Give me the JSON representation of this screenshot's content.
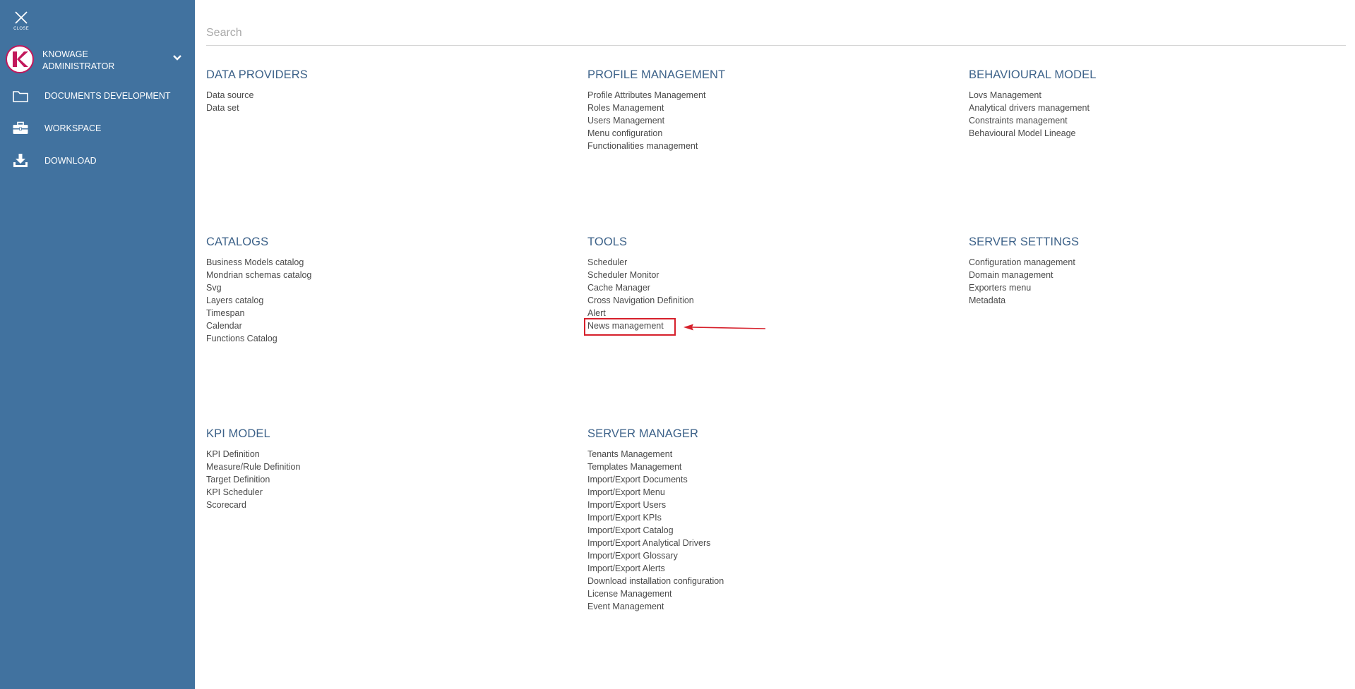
{
  "sidebar": {
    "close_label": "CLOSE",
    "user": {
      "line1": "KNOWAGE",
      "line2": "ADMINISTRATOR",
      "avatar_icon": "knowage-logo",
      "brand_color": "#c2185b"
    },
    "items": [
      {
        "label": "DOCUMENTS DEVELOPMENT",
        "icon": "folder-icon"
      },
      {
        "label": "WORKSPACE",
        "icon": "briefcase-icon"
      },
      {
        "label": "DOWNLOAD",
        "icon": "download-icon"
      }
    ],
    "background_color": "#41729f"
  },
  "search": {
    "placeholder": "Search",
    "value": ""
  },
  "sections": [
    {
      "title": "DATA PROVIDERS",
      "links": [
        "Data source",
        "Data set"
      ]
    },
    {
      "title": "PROFILE MANAGEMENT",
      "links": [
        "Profile Attributes Management",
        "Roles Management",
        "Users Management",
        "Menu configuration",
        "Functionalities management"
      ]
    },
    {
      "title": "BEHAVIOURAL MODEL",
      "links": [
        "Lovs Management",
        "Analytical drivers management",
        "Constraints management",
        "Behavioural Model Lineage"
      ]
    },
    {
      "title": "CATALOGS",
      "links": [
        "Business Models catalog",
        "Mondrian schemas catalog",
        "Svg",
        "Layers catalog",
        "Timespan",
        "Calendar",
        "Functions Catalog"
      ]
    },
    {
      "title": "TOOLS",
      "links": [
        "Scheduler",
        "Scheduler Monitor",
        "Cache Manager",
        "Cross Navigation Definition",
        "Alert",
        "News management"
      ]
    },
    {
      "title": "SERVER SETTINGS",
      "links": [
        "Configuration management",
        "Domain management",
        "Exporters menu",
        "Metadata"
      ]
    },
    {
      "title": "KPI MODEL",
      "links": [
        "KPI Definition",
        "Measure/Rule Definition",
        "Target Definition",
        "KPI Scheduler",
        "Scorecard"
      ]
    },
    {
      "title": "SERVER MANAGER",
      "links": [
        "Tenants Management",
        "Templates Management",
        "Import/Export Documents",
        "Import/Export Menu",
        "Import/Export Users",
        "Import/Export KPIs",
        "Import/Export Catalog",
        "Import/Export Analytical Drivers",
        "Import/Export Glossary",
        "Import/Export Alerts",
        "Download installation configuration",
        "License Management",
        "Event Management"
      ]
    }
  ],
  "annotation": {
    "highlight_color": "#d6202b"
  }
}
